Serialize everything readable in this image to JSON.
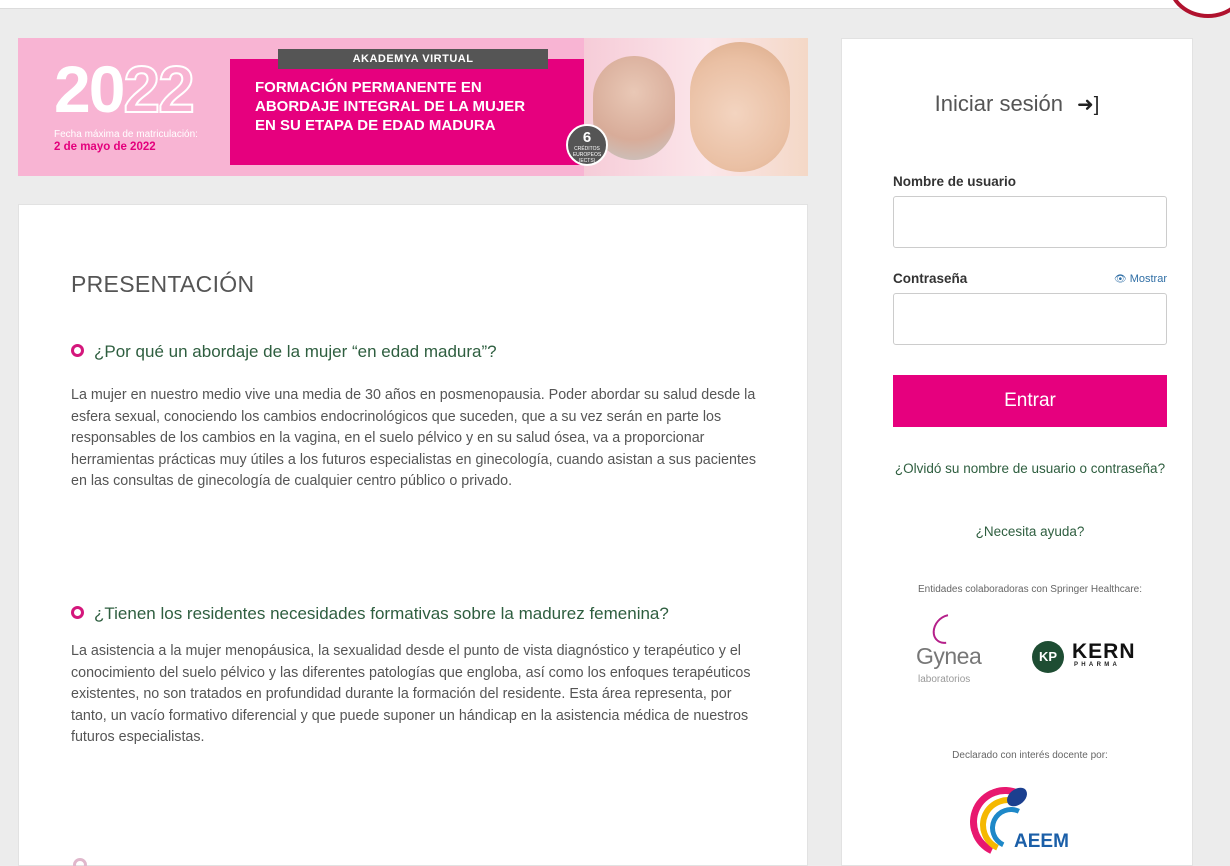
{
  "banner": {
    "year_part1": "20",
    "year_part2": "22",
    "deadline_label": "Fecha máxima de matriculación:",
    "deadline_date": "2 de mayo de 2022",
    "brand": "AKADEMYA VIRTUAL",
    "title_line1": "FORMACIÓN PERMANENTE EN",
    "title_line2": "ABORDAJE INTEGRAL DE LA MUJER",
    "title_line3": "EN SU ETAPA DE EDAD MADURA",
    "credits_number": "6",
    "credits_text": "CRÉDITOS EUROPEOS (ECTS)"
  },
  "main": {
    "heading": "PRESENTACIÓN",
    "sections": [
      {
        "question": "¿Por qué un abordaje de la mujer “en edad madura”?",
        "body": "La mujer en nuestro medio vive una media de 30 años en posmenopausia. Poder abordar su salud desde la esfera sexual, conociendo los cambios endocrinológicos que suceden, que a su vez serán en parte los responsables de los cambios en la vagina, en el suelo pélvico y en su salud ósea, va a proporcionar herramientas prácticas muy útiles a los futuros especialistas en ginecología, cuando asistan a sus pacientes en las consultas de ginecología de cualquier centro público o privado."
      },
      {
        "question": "¿Tienen los residentes necesidades formativas sobre la madurez femenina?",
        "body": "La asistencia a la mujer menopáusica, la sexualidad desde el punto de vista diagnóstico y terapéutico y el conocimiento del suelo pélvico y las diferentes patologías que engloba, así como los enfoques terapéuticos existentes, no son tratados en profundidad durante la formación del residente. Esta área representa, por tanto, un vacío formativo diferencial y que puede suponer un hándicap en la asistencia médica de nuestros futuros especialistas."
      }
    ]
  },
  "login": {
    "title": "Iniciar sesión",
    "title_icon": "sign-in-icon",
    "username_label": "Nombre de usuario",
    "username_value": "",
    "password_label": "Contraseña",
    "password_value": "",
    "show_password": "Mostrar",
    "submit": "Entrar",
    "forgot_link": "¿Olvidó su nombre de usuario o contraseña?",
    "help_link": "¿Necesita ayuda?",
    "sponsors_label": "Entidades colaboradoras con Springer Healthcare:",
    "declared_label": "Declarado con interés docente por:"
  },
  "sponsors": {
    "gynea_name": "Gynea",
    "gynea_sub": "laboratorios",
    "kern_name": "KERN",
    "kern_sub": "PHARMA",
    "aeem_name": "AEEM"
  },
  "colors": {
    "accent": "#e6007e",
    "link": "#2e5e3f",
    "background": "#ececec"
  }
}
